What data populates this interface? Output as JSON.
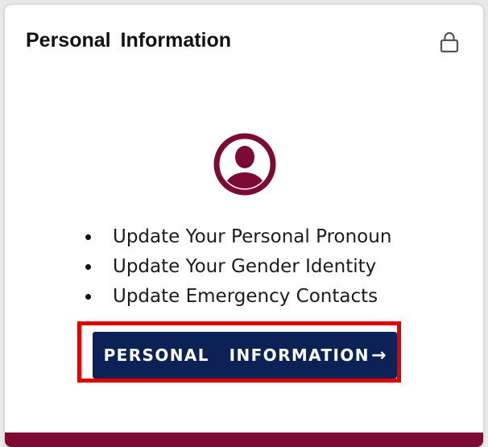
{
  "card": {
    "title": "Personal  Information",
    "lock_icon": "lock-icon",
    "avatar_icon": "user-avatar-icon",
    "bullets": [
      "Update Your Personal Pronoun",
      "Update Your Gender Identity",
      "Update Emergency Contacts"
    ],
    "button": {
      "label": "PERSONAL  INFORMATION",
      "arrow": "→"
    }
  },
  "colors": {
    "accent_maroon": "#7c0a33",
    "button_navy": "#0c2256",
    "highlight_red": "#e00000"
  }
}
